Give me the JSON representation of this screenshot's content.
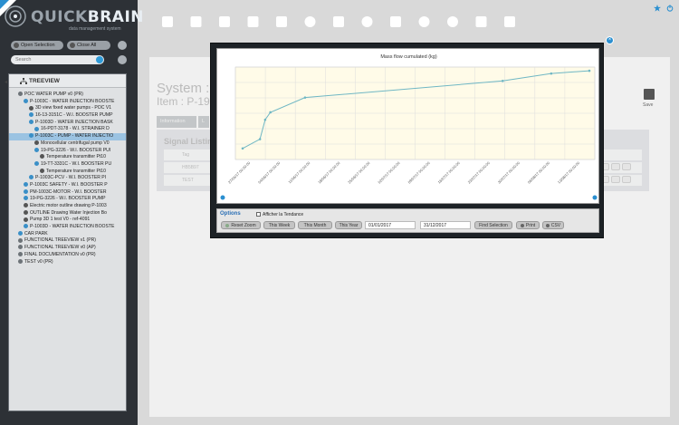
{
  "app": {
    "name_light": "QUICK",
    "name_bold": "BRAIN",
    "subtitle": "data management system"
  },
  "sidebar": {
    "open_selection": "Open Selection",
    "close_all": "Close All",
    "search_placeholder": "Search",
    "tree_title": "TREEVIEW",
    "tree": [
      {
        "label": "POC WATER PUMP v0 (PR)",
        "level": 0,
        "icon": "folder-icon"
      },
      {
        "label": "P-1003C - WATER INJECTION BOOSTE",
        "level": 1,
        "icon": "gear-icon"
      },
      {
        "label": "3D view fixed water pumps - POC V1",
        "level": 2,
        "icon": "document-icon"
      },
      {
        "label": "16-13-3151C - W.I. BOOSTER PUMP",
        "level": 2,
        "icon": "gear-icon"
      },
      {
        "label": "P-1003D - WATER INJECTION BASK",
        "level": 2,
        "icon": "gear-icon"
      },
      {
        "label": "16-PDT-3178 - W.I. STRAINER D",
        "level": 3,
        "icon": "gear-icon"
      },
      {
        "label": "P-1003C - PUMP - WATER INJECTIO",
        "level": 2,
        "icon": "gear-icon",
        "selected": true
      },
      {
        "label": "Monocellular centrifugal pump V0",
        "level": 3,
        "icon": "document-icon"
      },
      {
        "label": "19-PG-3226 - W.I. BOOSTER PUI",
        "level": 3,
        "icon": "gear-icon"
      },
      {
        "label": "Temperature transmitter Pt10",
        "level": 4,
        "icon": "document-icon"
      },
      {
        "label": "19-TT-3331C - W.I. BOOSTER PU",
        "level": 3,
        "icon": "gear-icon"
      },
      {
        "label": "Temperature transmitter Pt10",
        "level": 4,
        "icon": "document-icon"
      },
      {
        "label": "P-1003C-PCV - W.I. BOOSTER PI",
        "level": 2,
        "icon": "gear-icon"
      },
      {
        "label": "P-1003C SAFETY - W.I. BOOSTER P",
        "level": 1,
        "icon": "gear-icon"
      },
      {
        "label": "PM-1003C-MOTOR - W.I. BOOSTER",
        "level": 1,
        "icon": "gear-icon"
      },
      {
        "label": "19-PG-3226 - W.I. BOOSTER PUMP",
        "level": 1,
        "icon": "gear-icon"
      },
      {
        "label": "Electric motor outline drawing P-1003",
        "level": 1,
        "icon": "document-icon"
      },
      {
        "label": "OUTLINE Drawing Water Injection Bo",
        "level": 1,
        "icon": "document-icon"
      },
      {
        "label": "Pump 3D 1 test V0 - ref-4091",
        "level": 1,
        "icon": "document-icon"
      },
      {
        "label": "P-1003D - WATER INJECTION BOOSTE",
        "level": 1,
        "icon": "gear-icon"
      },
      {
        "label": "CAR PARK",
        "level": 0,
        "icon": "gear-icon"
      },
      {
        "label": "FUNCTIONAL TREEVIEW v1 (PR)",
        "level": 0,
        "icon": "folder-icon"
      },
      {
        "label": "FUNCTIONAL TREEVIEW v0 (AP)",
        "level": 0,
        "icon": "folder-icon"
      },
      {
        "label": "FINAL DOCUMENTATION v0 (PR)",
        "level": 0,
        "icon": "folder-icon"
      },
      {
        "label": "TEST v0 (PR)",
        "level": 0,
        "icon": "folder-icon"
      }
    ]
  },
  "toolbar": {
    "icons": [
      "home-icon",
      "bolt-icon",
      "documents-icon",
      "cube-icon",
      "folder-icon",
      "settings-icon",
      "database-icon",
      "gear-cog-icon",
      "database-settings-icon",
      "timer-icon",
      "pie-icon",
      "tools-icon",
      "lightbulb-icon"
    ]
  },
  "main": {
    "system_title": "System :",
    "item_title": "Item : P-19",
    "save_label": "Save",
    "tabs": [
      "Information",
      "L"
    ],
    "signals_title": "Signal Listin",
    "signal_rows": [
      {
        "col": "Tag",
        "val": ""
      },
      {
        "col": "",
        "val": "HB5B97"
      },
      {
        "col": "",
        "val": "TEST"
      }
    ]
  },
  "chart_data": {
    "type": "line",
    "title": "Mass flow cumulated (kg)",
    "x": [
      "27/05/17 00:00:00",
      "04/06/17 00:00:00",
      "11/06/17 00:00:00",
      "18/06/17 00:00:00",
      "25/06/17 00:00:00",
      "02/07/17 00:00:00",
      "09/07/17 00:00:00",
      "16/07/17 00:00:00",
      "23/07/17 00:00:00",
      "30/07/17 00:00:00",
      "06/08/17 00:00:00",
      "13/08/17 00:00:00"
    ],
    "series": [
      {
        "values_norm": [
          [
            0.0,
            0.12
          ],
          [
            0.05,
            0.22
          ],
          [
            0.065,
            0.43
          ],
          [
            0.08,
            0.51
          ],
          [
            0.18,
            0.67
          ],
          [
            0.75,
            0.85
          ],
          [
            0.89,
            0.93
          ],
          [
            1.0,
            0.96
          ]
        ]
      }
    ],
    "grid": true,
    "color": "#6fb7c4"
  },
  "options": {
    "title": "Options",
    "checkbox_label": "Afficher la Tendance",
    "buttons": [
      "Reset Zoom",
      "This Week",
      "This Month",
      "This Year"
    ],
    "date_from": "01/01/2017",
    "date_to": "31/12/2017",
    "find_selection": "Find Selection",
    "print": "Print",
    "csv": "CSV"
  }
}
